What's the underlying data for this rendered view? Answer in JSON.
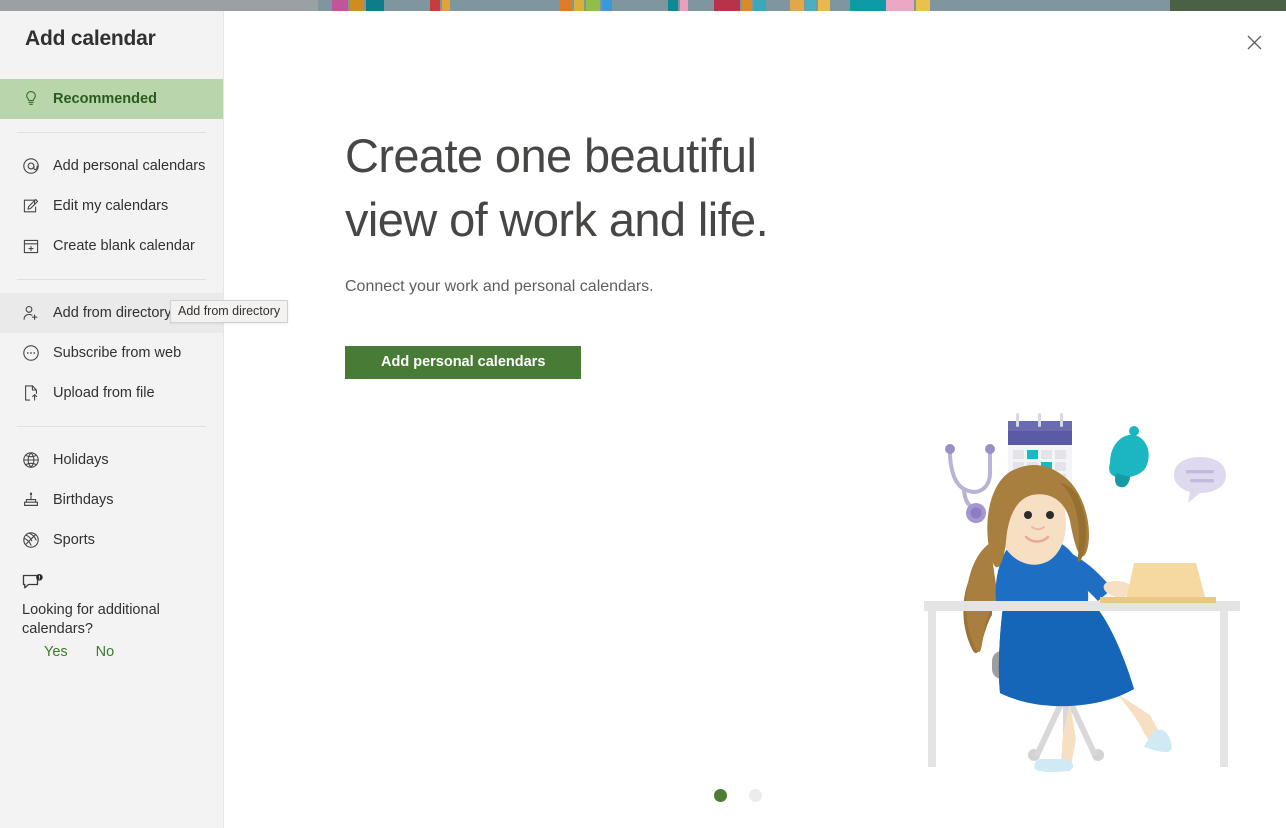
{
  "background": {
    "strip_color_center": "#7f969e",
    "strip_color_left": "#9aa0a3",
    "strip_color_right": "#4a6145"
  },
  "dialog": {
    "title": "Add calendar",
    "close_label": "Close"
  },
  "sidebar": {
    "groups": [
      {
        "items": [
          {
            "label": "Recommended",
            "icon": "lightbulb-icon",
            "selected": true
          }
        ]
      },
      {
        "items": [
          {
            "label": "Add personal calendars",
            "icon": "at-sign-icon",
            "selected": false
          },
          {
            "label": "Edit my calendars",
            "icon": "edit-note-icon",
            "selected": false
          },
          {
            "label": "Create blank calendar",
            "icon": "calendar-plus-icon",
            "selected": false
          }
        ]
      },
      {
        "items": [
          {
            "label": "Add from directory",
            "icon": "person-add-icon",
            "selected": false,
            "hovered": true
          },
          {
            "label": "Subscribe from web",
            "icon": "subscribe-icon",
            "selected": false
          },
          {
            "label": "Upload from file",
            "icon": "file-upload-icon",
            "selected": false
          }
        ]
      },
      {
        "items": [
          {
            "label": "Holidays",
            "icon": "globe-icon",
            "selected": false
          },
          {
            "label": "Birthdays",
            "icon": "birthday-cake-icon",
            "selected": false
          },
          {
            "label": "Sports",
            "icon": "sports-ball-icon",
            "selected": false
          }
        ]
      }
    ],
    "feedback": {
      "icon": "feedback-bubble-icon",
      "prompt": "Looking for additional calendars?",
      "yes_label": "Yes",
      "no_label": "No"
    },
    "tooltip": {
      "text": "Add from directory"
    }
  },
  "main": {
    "hero_title_line1": "Create one beautiful",
    "hero_title_line2": "view of work and life.",
    "hero_subtitle": "Connect your work and personal calendars.",
    "cta_label": "Add personal calendars",
    "illustration": "woman-at-desk-with-laptop-illustration",
    "pagination": {
      "total": 2,
      "active_index": 0,
      "active_color": "#4b7d33",
      "inactive_color": "#ececec"
    }
  },
  "colors": {
    "accent_green": "#477b36",
    "selected_nav_bg": "#b8d5ab",
    "selected_nav_text": "#2b5a1e",
    "sidebar_bg": "#f3f3f3",
    "title_text": "#323130",
    "hero_text": "#484644"
  }
}
